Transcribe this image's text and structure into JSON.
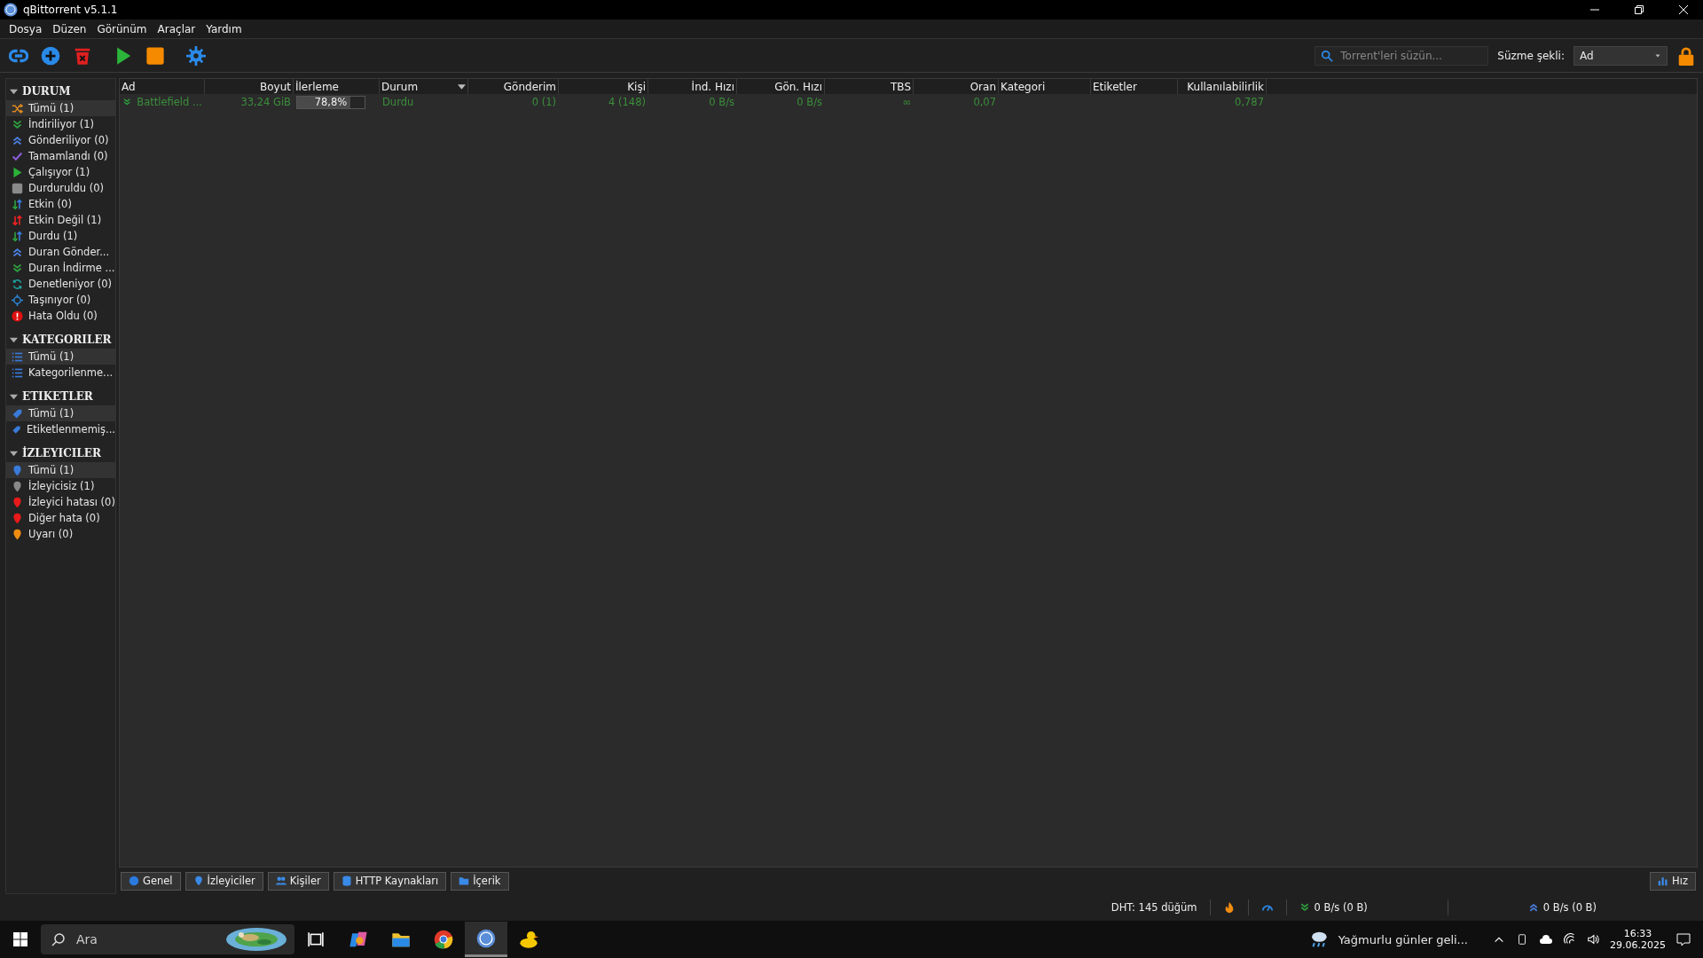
{
  "window": {
    "title": "qBittorrent v5.1.1"
  },
  "menu": [
    "Dosya",
    "Düzen",
    "Görünüm",
    "Araçlar",
    "Yardım"
  ],
  "search": {
    "placeholder": "Torrent'leri süzün..."
  },
  "filter": {
    "label": "Süzme şekli:",
    "value": "Ad"
  },
  "sidebar": [
    {
      "title": "DURUM",
      "expanded": true,
      "items": [
        {
          "label": "Tümü (1)",
          "selected": true
        },
        {
          "label": "İndiriliyor (1)",
          "selected": false
        },
        {
          "label": "Gönderiliyor (0)",
          "selected": false
        },
        {
          "label": "Tamamlandı (0)",
          "selected": false
        },
        {
          "label": "Çalışıyor (1)",
          "selected": false
        },
        {
          "label": "Durduruldu (0)",
          "selected": false
        },
        {
          "label": "Etkin (0)",
          "selected": false
        },
        {
          "label": "Etkin Değil (1)",
          "selected": false
        },
        {
          "label": "Durdu (1)",
          "selected": false
        },
        {
          "label": "Duran Gönder...",
          "selected": false
        },
        {
          "label": "Duran İndirme ...",
          "selected": false
        },
        {
          "label": "Denetleniyor (0)",
          "selected": false
        },
        {
          "label": "Taşınıyor (0)",
          "selected": false
        },
        {
          "label": "Hata Oldu (0)",
          "selected": false
        }
      ]
    },
    {
      "title": "KATEGORILER",
      "expanded": true,
      "items": [
        {
          "label": "Tümü (1)",
          "selected": true
        },
        {
          "label": "Kategorilenme...",
          "selected": false
        }
      ]
    },
    {
      "title": "ETIKETLER",
      "expanded": true,
      "items": [
        {
          "label": "Tümü (1)",
          "selected": true
        },
        {
          "label": "Etiketlenmemiş...",
          "selected": false
        }
      ]
    },
    {
      "title": "İZLEYICILER",
      "expanded": true,
      "items": [
        {
          "label": "Tümü (1)",
          "selected": true
        },
        {
          "label": "İzleyicisiz (1)",
          "selected": false
        },
        {
          "label": "İzleyici hatası (0)",
          "selected": false
        },
        {
          "label": "Diğer hata (0)",
          "selected": false
        },
        {
          "label": "Uyarı (0)",
          "selected": false
        }
      ]
    }
  ],
  "table": {
    "columns": [
      {
        "label": "Ad",
        "sorted": false
      },
      {
        "label": "Boyut",
        "sorted": false
      },
      {
        "label": "İlerleme",
        "sorted": false
      },
      {
        "label": "Durum",
        "sorted": true
      },
      {
        "label": "Gönderim",
        "sorted": false
      },
      {
        "label": "Kişi",
        "sorted": false
      },
      {
        "label": "İnd. Hızı",
        "sorted": false
      },
      {
        "label": "Gön. Hızı",
        "sorted": false
      },
      {
        "label": "TBS",
        "sorted": false
      },
      {
        "label": "Oran",
        "sorted": false
      },
      {
        "label": "Kategori",
        "sorted": false
      },
      {
        "label": "Etiketler",
        "sorted": false
      },
      {
        "label": "Kullanılabilirlik",
        "sorted": false
      }
    ],
    "rows": [
      {
        "name": "Battlefield ...",
        "size": "33,24 GiB",
        "progress": {
          "level": 0.788,
          "text": "78,8%"
        },
        "status": "Durdu",
        "seeds": "0 (1)",
        "peers": "4 (148)",
        "down_speed": "0 B/s",
        "up_speed": "0 B/s",
        "eta": "∞",
        "ratio": "0,07",
        "availability": "0,787"
      }
    ]
  },
  "bottom_tabs": [
    "Genel",
    "İzleyiciler",
    "Kişiler",
    "HTTP Kaynakları",
    "İçerik"
  ],
  "speed_button": "Hız",
  "status_bar": {
    "dht": "DHT: 145 düğüm",
    "download": "0 B/s (0 B)",
    "upload": "0 B/s (0 B)"
  },
  "taskbar": {
    "search_placeholder": "Ara",
    "weather": "Yağmurlu günler geli...",
    "time": "16:33",
    "date": "29.06.2025"
  }
}
